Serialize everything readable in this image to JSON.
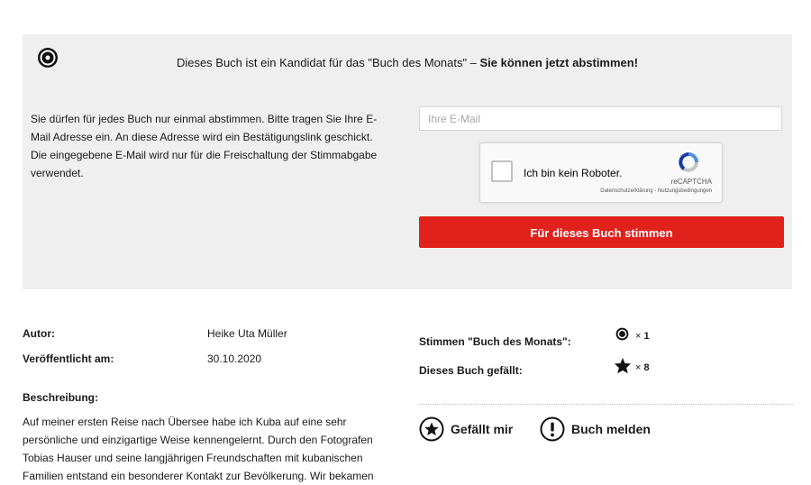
{
  "panel": {
    "headline_prefix": "Dieses Buch ist ein Kandidat für das \"Buch des Monats\" – ",
    "headline_bold": "Sie können jetzt abstimmen!",
    "intro": "Sie dürfen für jedes Buch nur einmal abstimmen. Bitte tragen Sie Ihre E-Mail Adresse ein. An diese Adresse wird ein Bestätigungslink geschickt. Die eingegebene E-Mail wird nur für die Freischaltung der Stimmabgabe verwendet.",
    "email_placeholder": "Ihre E-Mail",
    "email_value": "",
    "captcha": {
      "label": "Ich bin kein Roboter.",
      "brand": "reCAPTCHA",
      "terms": "Datenschutzerklärung - Nutzungsbedingungen"
    },
    "vote_button": "Für dieses Buch stimmen"
  },
  "book": {
    "author_label": "Autor:",
    "author": "Heike Uta Müller",
    "published_label": "Veröffentlicht am:",
    "published": "30.10.2020",
    "description_label": "Beschreibung:",
    "description": "Auf meiner ersten Reise nach Übersee habe ich Kuba auf eine sehr persönliche und einzigartige Weise kennengelernt. Durch den Fotografen Tobias Hauser und seine langjährigen Freundschaften mit kubanischen Familien entstand ein besonderer Kontakt zur Bevölkerung. Wir bekamen"
  },
  "stats": {
    "votes_label": "Stimmen \"Buch des Monats\":",
    "votes_icon": "award-icon",
    "votes_count": "1",
    "likes_label": "Dieses Buch gefällt:",
    "likes_icon": "star-icon",
    "likes_count": "8",
    "times": "×"
  },
  "actions": {
    "like": "Gefällt mir",
    "like_icon": "star-circle-icon",
    "report": "Buch melden",
    "report_icon": "exclamation-circle-icon"
  },
  "colors": {
    "accent": "#e1221c",
    "panel_bg": "#efefef"
  }
}
